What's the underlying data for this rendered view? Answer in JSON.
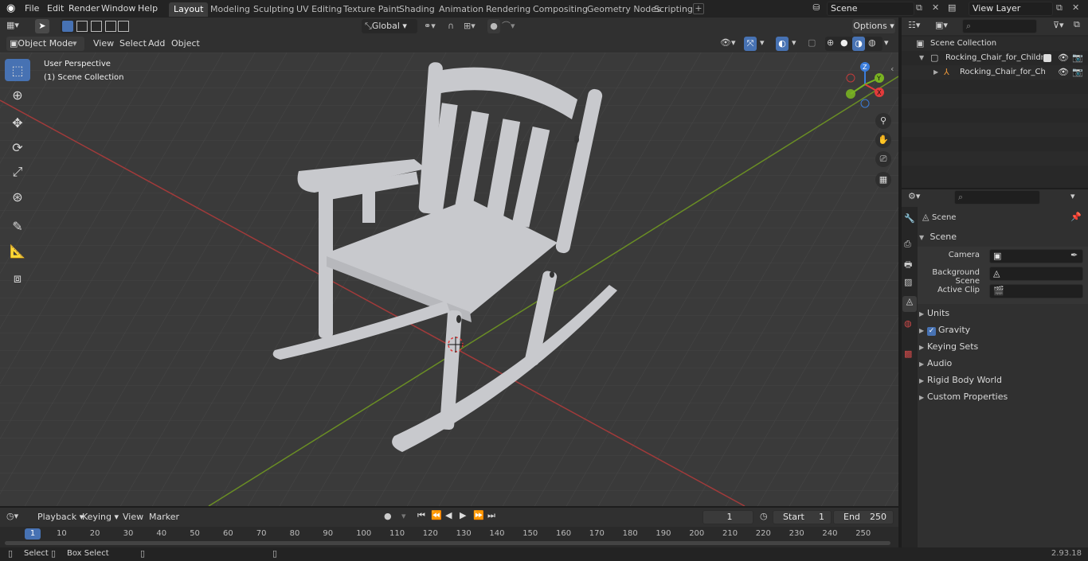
{
  "app": {
    "menus": [
      "File",
      "Edit",
      "Render",
      "Window",
      "Help"
    ],
    "workspaces": [
      "Layout",
      "Modeling",
      "Sculpting",
      "UV Editing",
      "Texture Paint",
      "Shading",
      "Animation",
      "Rendering",
      "Compositing",
      "Geometry Nodes",
      "Scripting"
    ],
    "active_workspace": "Layout",
    "scene_name": "Scene",
    "view_layer": "View Layer"
  },
  "viewport_header": {
    "mode": "Object Mode",
    "menus": [
      "View",
      "Select",
      "Add",
      "Object"
    ],
    "orientation": "Global",
    "options_label": "Options"
  },
  "viewport": {
    "perspective_label": "User Perspective",
    "collection_label": "(1) Scene Collection",
    "gizmo_axes": [
      "Z",
      "Y",
      "X"
    ]
  },
  "outliner": {
    "root": "Scene Collection",
    "items": [
      {
        "label": "Rocking_Chair_for_Children_F",
        "indent": 1
      },
      {
        "label": "Rocking_Chair_for_Childr",
        "indent": 2
      }
    ]
  },
  "properties": {
    "context_title": "Scene",
    "panel_title": "Scene",
    "fields": [
      {
        "label": "Camera",
        "value": ""
      },
      {
        "label": "Background Scene",
        "value": ""
      },
      {
        "label": "Active Clip",
        "value": ""
      }
    ],
    "sections": [
      "Units",
      "Gravity",
      "Keying Sets",
      "Audio",
      "Rigid Body World",
      "Custom Properties"
    ],
    "gravity_checked": true
  },
  "timeline": {
    "menus": [
      "Playback",
      "Keying",
      "View",
      "Marker"
    ],
    "current_frame": "1",
    "start_label": "Start",
    "start_value": "1",
    "end_label": "End",
    "end_value": "250",
    "ruler": [
      "1",
      "10",
      "20",
      "30",
      "40",
      "50",
      "60",
      "70",
      "80",
      "90",
      "100",
      "110",
      "120",
      "130",
      "140",
      "150",
      "160",
      "170",
      "180",
      "190",
      "200",
      "210",
      "220",
      "230",
      "240",
      "250"
    ]
  },
  "statusbar": {
    "select_label": "Select",
    "box_select_label": "Box Select",
    "version": "2.93.18"
  },
  "colors": {
    "accent": "#4772b3",
    "x_axis": "#e23b3b",
    "y_axis": "#79b322",
    "z_axis": "#3b7ddb",
    "background": "#3a3a3a"
  }
}
